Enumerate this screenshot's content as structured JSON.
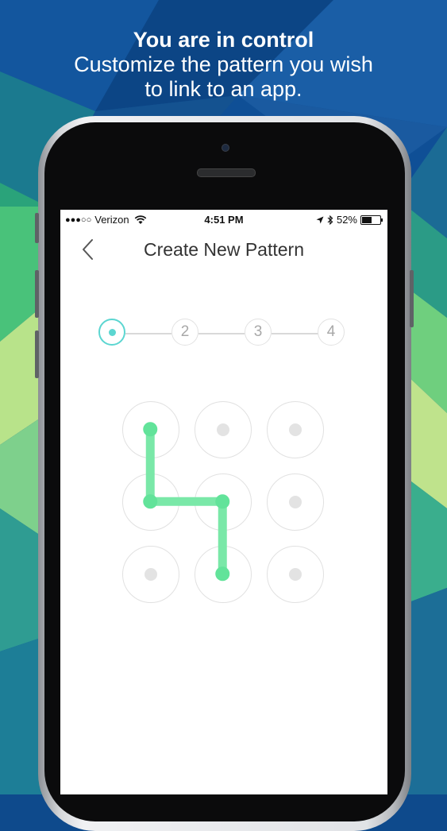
{
  "caption": {
    "title": "You are in control",
    "line1": "Customize the pattern you wish",
    "line2": "to link to an app."
  },
  "status_bar": {
    "carrier": "Verizon",
    "signal_dots": "●●●○○",
    "time": "4:51 PM",
    "battery": "52%"
  },
  "nav": {
    "title": "Create New Pattern",
    "back_icon": "chevron-left-icon"
  },
  "steps": [
    {
      "label": "",
      "active": true
    },
    {
      "label": "2",
      "active": false
    },
    {
      "label": "3",
      "active": false
    },
    {
      "label": "4",
      "active": false
    }
  ],
  "pattern": {
    "grid": [
      3,
      3
    ],
    "selected_sequence": [
      [
        0,
        0
      ],
      [
        1,
        0
      ],
      [
        1,
        1
      ],
      [
        2,
        1
      ]
    ]
  },
  "colors": {
    "accent": "#5cd6d1",
    "pattern_line": "#7ae8a8",
    "pattern_node": "#62e39a"
  }
}
